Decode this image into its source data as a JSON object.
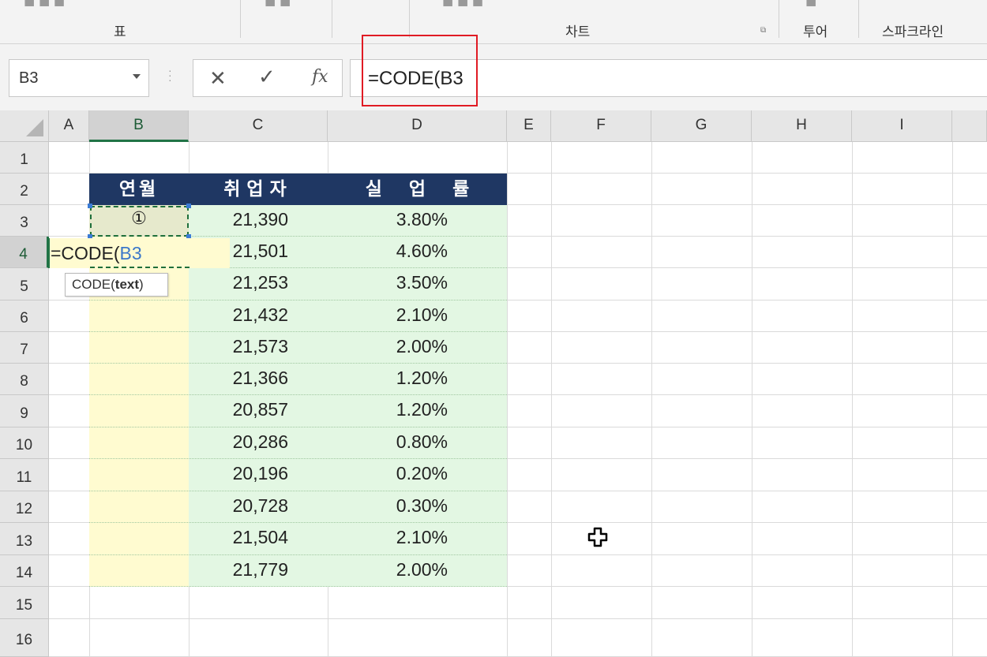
{
  "ribbon": {
    "groups": [
      "표",
      "차트",
      "투어",
      "스파크라인"
    ]
  },
  "name_box": {
    "value": "B3"
  },
  "formula_bar": {
    "cancel": "✕",
    "enter": "✓",
    "insert_function": "fx",
    "value": "=CODE(B3"
  },
  "columns": [
    "A",
    "B",
    "C",
    "D",
    "E",
    "F",
    "G",
    "H",
    "I"
  ],
  "rows": [
    "1",
    "2",
    "3",
    "4",
    "5",
    "6",
    "7",
    "8",
    "9",
    "10",
    "11",
    "12",
    "13",
    "14",
    "15",
    "16"
  ],
  "table": {
    "headers": [
      "연월",
      "취업자",
      "실 업 률"
    ],
    "employed": [
      "21,390",
      "21,501",
      "21,253",
      "21,432",
      "21,573",
      "21,366",
      "20,857",
      "20,286",
      "20,196",
      "20,728",
      "21,504",
      "21,779"
    ],
    "unemployment": [
      "3.80%",
      "4.60%",
      "3.50%",
      "2.10%",
      "2.00%",
      "1.20%",
      "1.20%",
      "0.80%",
      "0.20%",
      "0.30%",
      "2.10%",
      "2.00%"
    ]
  },
  "b3_marker": "①",
  "editing": {
    "prefix": "=CODE(",
    "ref": "B3"
  },
  "tooltip": {
    "func": "CODE(",
    "arg": "text",
    "close": ")"
  }
}
